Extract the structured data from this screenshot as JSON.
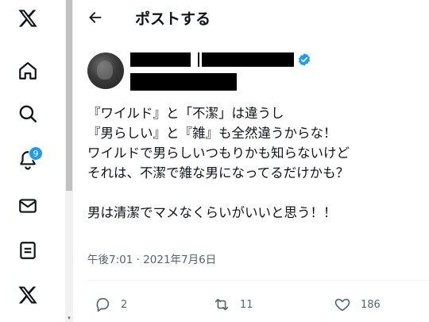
{
  "header": {
    "title": "ポストする"
  },
  "sidebar": {
    "items": [
      {
        "name": "x-logo-icon"
      },
      {
        "name": "home-icon"
      },
      {
        "name": "search-icon"
      },
      {
        "name": "notifications-icon",
        "badge": "9"
      },
      {
        "name": "messages-icon"
      },
      {
        "name": "lists-icon"
      },
      {
        "name": "x-premium-icon"
      }
    ]
  },
  "tweet": {
    "author": {
      "avatar": "avatar",
      "name_redacted": true,
      "handle_redacted": true,
      "verified": true
    },
    "text": "『ワイルド』と「不潔」は違うし\n『男らしい』と『雑』も全然違うからな！\nワイルドで男らしいつもりかも知らないけど\nそれは、不潔で雑な男になってるだけかも？\n\n男は清潔でマメなくらいがいいと思う！！",
    "timestamp": "午後7:01 · 2021年7月6日"
  },
  "actions": {
    "reply_count": "2",
    "repost_count": "11",
    "like_count": "186"
  },
  "colors": {
    "accent": "#1d9bf0",
    "text": "#0f1419",
    "secondary": "#536471"
  }
}
